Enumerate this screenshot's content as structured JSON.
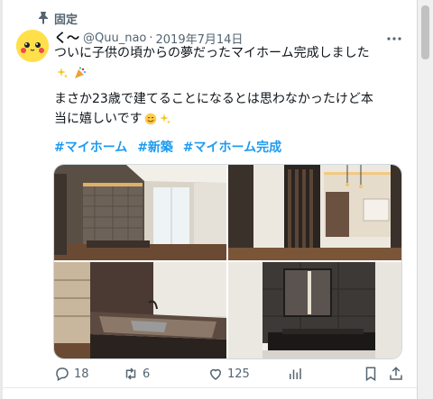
{
  "pinned": {
    "label": "固定",
    "icon": "pin-icon"
  },
  "tweet": {
    "author_name": "く〜",
    "handle": "@Quu_nao",
    "separator": "·",
    "date": "2019年7月14日",
    "avatar": "pikachu-avatar",
    "text_lines": [
      "ついに子供の頃からの夢だったマイホーム完成しました",
      "",
      "まさか23歳で建てることになるとは思わなかったけど本",
      "当に嬉しいです"
    ],
    "emojis_line2": [
      "sparkles-emoji",
      "party-popper-emoji"
    ],
    "emojis_line4": [
      "smiling-face-emoji",
      "sparkles-emoji"
    ],
    "hashtags": [
      "#マイホーム",
      "#新築",
      "#マイホーム完成"
    ]
  },
  "media": [
    {
      "name": "living-room-photo"
    },
    {
      "name": "dining-room-photo"
    },
    {
      "name": "kitchen-photo"
    },
    {
      "name": "washroom-photo"
    }
  ],
  "actions": {
    "reply_count": "18",
    "retweet_count": "6",
    "like_count": "125",
    "views": "",
    "bookmark": "",
    "share": ""
  },
  "colors": {
    "link": "#1d9bf0",
    "secondary": "#536471",
    "text": "#0f1419"
  }
}
